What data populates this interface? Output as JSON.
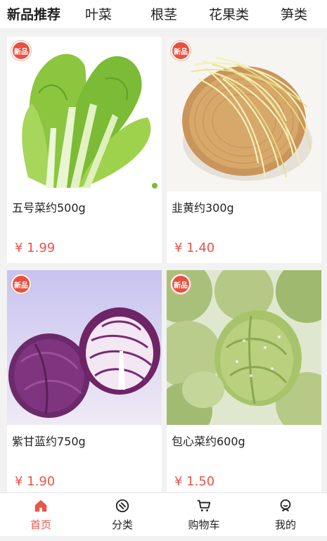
{
  "category_tabs": [
    {
      "label": "新品推荐",
      "active": true
    },
    {
      "label": "叶菜",
      "active": false
    },
    {
      "label": "根茎",
      "active": false
    },
    {
      "label": "花果类",
      "active": false
    },
    {
      "label": "笋类",
      "active": false
    }
  ],
  "badge_label": "新品",
  "products": [
    {
      "name": "五号菜约500g",
      "price": "¥ 1.99",
      "image": "leafy-greens"
    },
    {
      "name": "韭黄约300g",
      "price": "¥ 1.40",
      "image": "yellow-chives-basket"
    },
    {
      "name": "紫甘蓝约750g",
      "price": "¥ 1.90",
      "image": "red-cabbage"
    },
    {
      "name": "包心菜约600g",
      "price": "¥ 1.50",
      "image": "brussels-sprouts"
    }
  ],
  "bottom_nav": [
    {
      "label": "首页",
      "icon": "home-icon",
      "active": true
    },
    {
      "label": "分类",
      "icon": "category-icon",
      "active": false
    },
    {
      "label": "购物车",
      "icon": "cart-icon",
      "active": false
    },
    {
      "label": "我的",
      "icon": "profile-icon",
      "active": false
    }
  ],
  "colors": {
    "accent": "#e6564a",
    "badge": "#e8503f",
    "background": "#f2f2f2"
  }
}
